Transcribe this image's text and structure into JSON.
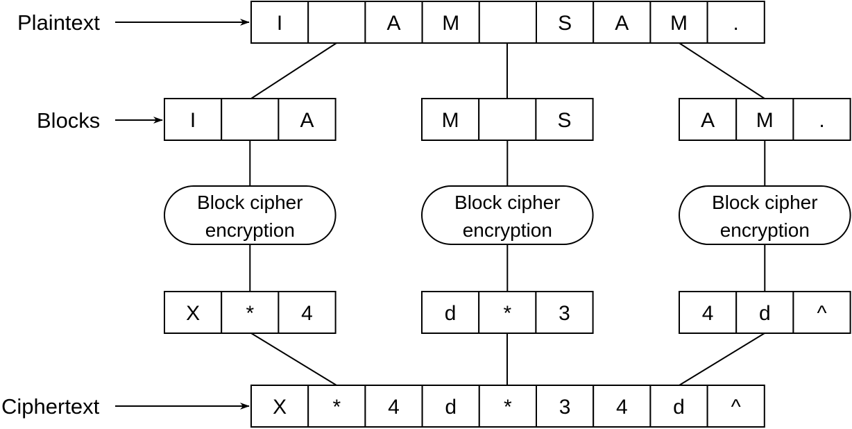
{
  "labels": {
    "plaintext": "Plaintext",
    "blocks": "Blocks",
    "ciphertext": "Ciphertext"
  },
  "plaintext": [
    "I",
    "",
    "A",
    "M",
    "",
    "S",
    "A",
    "M",
    "."
  ],
  "blocks": [
    [
      "I",
      "",
      "A"
    ],
    [
      "M",
      "",
      "S"
    ],
    [
      "A",
      "M",
      "."
    ]
  ],
  "cipher_step": {
    "line1": "Block cipher",
    "line2": "encryption"
  },
  "cipher_blocks": [
    [
      "X",
      "*",
      "4"
    ],
    [
      "d",
      "*",
      "3"
    ],
    [
      "4",
      "d",
      "^"
    ]
  ],
  "ciphertext": [
    "X",
    "*",
    "4",
    "d",
    "*",
    "3",
    "4",
    "d",
    "^"
  ]
}
